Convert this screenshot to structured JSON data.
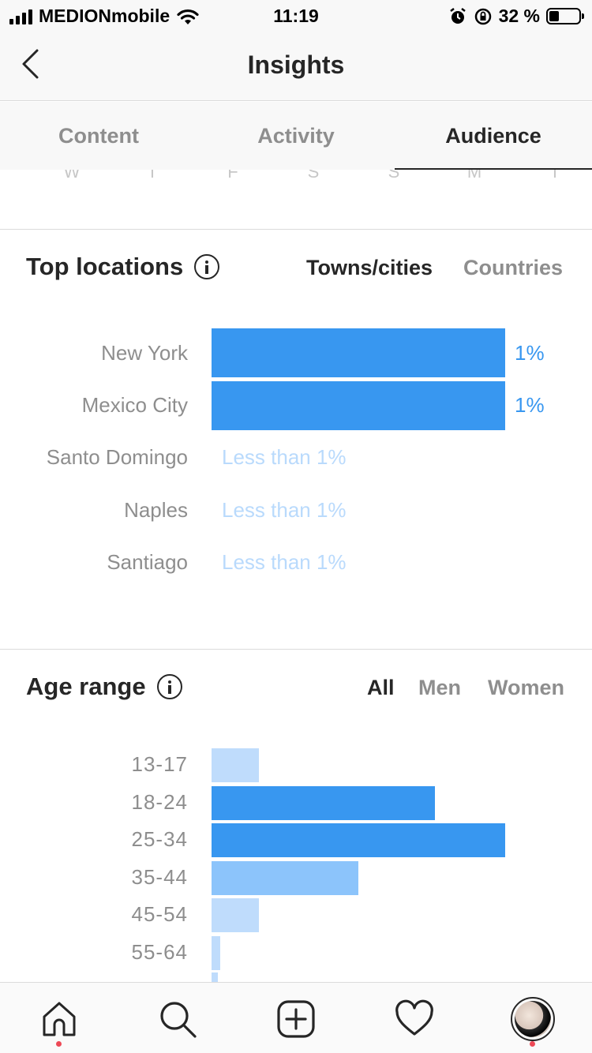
{
  "status_bar": {
    "carrier": "MEDIONmobile",
    "time": "11:19",
    "battery": "32 %",
    "battery_level": 0.32
  },
  "header": {
    "title": "Insights"
  },
  "tabs": [
    {
      "label": "Content",
      "active": false
    },
    {
      "label": "Activity",
      "active": false
    },
    {
      "label": "Audience",
      "active": true
    }
  ],
  "week_days": [
    "W",
    "T",
    "F",
    "S",
    "S",
    "M",
    "T"
  ],
  "top_locations": {
    "title": "Top locations",
    "toggles": [
      {
        "label": "Towns/cities",
        "active": true
      },
      {
        "label": "Countries",
        "active": false
      }
    ],
    "rows": [
      {
        "label": "New York",
        "value": "1%",
        "fraction": 1.0
      },
      {
        "label": "Mexico City",
        "value": "1%",
        "fraction": 1.0
      },
      {
        "label": "Santo Domingo",
        "value": "Less than 1%",
        "fraction": 0
      },
      {
        "label": "Naples",
        "value": "Less than 1%",
        "fraction": 0
      },
      {
        "label": "Santiago",
        "value": "Less than 1%",
        "fraction": 0
      }
    ]
  },
  "age_range": {
    "title": "Age range",
    "toggles": [
      {
        "label": "All",
        "active": true
      },
      {
        "label": "Men",
        "active": false
      },
      {
        "label": "Women",
        "active": false
      }
    ],
    "rows": [
      {
        "label": "13-17",
        "fraction": 0.16,
        "shade": "light"
      },
      {
        "label": "18-24",
        "fraction": 0.76,
        "shade": "dark"
      },
      {
        "label": "25-34",
        "fraction": 1.0,
        "shade": "dark"
      },
      {
        "label": "35-44",
        "fraction": 0.5,
        "shade": "mid"
      },
      {
        "label": "45-54",
        "fraction": 0.16,
        "shade": "light"
      },
      {
        "label": "55-64",
        "fraction": 0.03,
        "shade": "light"
      }
    ]
  },
  "colors": {
    "accent": "#3897f0",
    "bar_mid": "#8cc4fb",
    "bar_light": "#bfdcfc",
    "notification_dot": "#ed4956"
  },
  "bottom_nav": [
    {
      "icon": "home-icon",
      "active": true
    },
    {
      "icon": "search-icon"
    },
    {
      "icon": "add-post-icon"
    },
    {
      "icon": "heart-icon"
    },
    {
      "icon": "profile-avatar"
    }
  ]
}
